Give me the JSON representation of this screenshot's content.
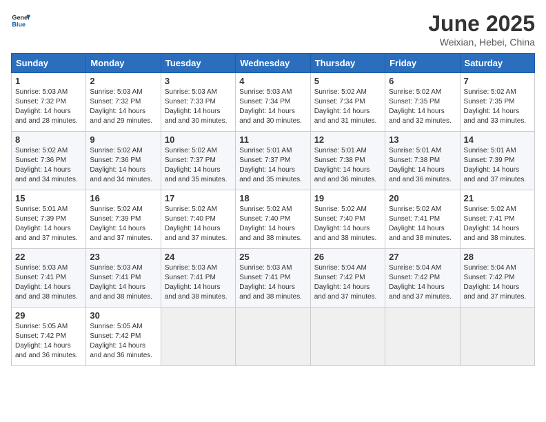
{
  "header": {
    "logo_general": "General",
    "logo_blue": "Blue",
    "title": "June 2025",
    "location": "Weixian, Hebei, China"
  },
  "columns": [
    "Sunday",
    "Monday",
    "Tuesday",
    "Wednesday",
    "Thursday",
    "Friday",
    "Saturday"
  ],
  "weeks": [
    [
      {
        "day": "1",
        "sunrise": "Sunrise: 5:03 AM",
        "sunset": "Sunset: 7:32 PM",
        "daylight": "Daylight: 14 hours and 28 minutes."
      },
      {
        "day": "2",
        "sunrise": "Sunrise: 5:03 AM",
        "sunset": "Sunset: 7:32 PM",
        "daylight": "Daylight: 14 hours and 29 minutes."
      },
      {
        "day": "3",
        "sunrise": "Sunrise: 5:03 AM",
        "sunset": "Sunset: 7:33 PM",
        "daylight": "Daylight: 14 hours and 30 minutes."
      },
      {
        "day": "4",
        "sunrise": "Sunrise: 5:03 AM",
        "sunset": "Sunset: 7:34 PM",
        "daylight": "Daylight: 14 hours and 30 minutes."
      },
      {
        "day": "5",
        "sunrise": "Sunrise: 5:02 AM",
        "sunset": "Sunset: 7:34 PM",
        "daylight": "Daylight: 14 hours and 31 minutes."
      },
      {
        "day": "6",
        "sunrise": "Sunrise: 5:02 AM",
        "sunset": "Sunset: 7:35 PM",
        "daylight": "Daylight: 14 hours and 32 minutes."
      },
      {
        "day": "7",
        "sunrise": "Sunrise: 5:02 AM",
        "sunset": "Sunset: 7:35 PM",
        "daylight": "Daylight: 14 hours and 33 minutes."
      }
    ],
    [
      {
        "day": "8",
        "sunrise": "Sunrise: 5:02 AM",
        "sunset": "Sunset: 7:36 PM",
        "daylight": "Daylight: 14 hours and 34 minutes."
      },
      {
        "day": "9",
        "sunrise": "Sunrise: 5:02 AM",
        "sunset": "Sunset: 7:36 PM",
        "daylight": "Daylight: 14 hours and 34 minutes."
      },
      {
        "day": "10",
        "sunrise": "Sunrise: 5:02 AM",
        "sunset": "Sunset: 7:37 PM",
        "daylight": "Daylight: 14 hours and 35 minutes."
      },
      {
        "day": "11",
        "sunrise": "Sunrise: 5:01 AM",
        "sunset": "Sunset: 7:37 PM",
        "daylight": "Daylight: 14 hours and 35 minutes."
      },
      {
        "day": "12",
        "sunrise": "Sunrise: 5:01 AM",
        "sunset": "Sunset: 7:38 PM",
        "daylight": "Daylight: 14 hours and 36 minutes."
      },
      {
        "day": "13",
        "sunrise": "Sunrise: 5:01 AM",
        "sunset": "Sunset: 7:38 PM",
        "daylight": "Daylight: 14 hours and 36 minutes."
      },
      {
        "day": "14",
        "sunrise": "Sunrise: 5:01 AM",
        "sunset": "Sunset: 7:39 PM",
        "daylight": "Daylight: 14 hours and 37 minutes."
      }
    ],
    [
      {
        "day": "15",
        "sunrise": "Sunrise: 5:01 AM",
        "sunset": "Sunset: 7:39 PM",
        "daylight": "Daylight: 14 hours and 37 minutes."
      },
      {
        "day": "16",
        "sunrise": "Sunrise: 5:02 AM",
        "sunset": "Sunset: 7:39 PM",
        "daylight": "Daylight: 14 hours and 37 minutes."
      },
      {
        "day": "17",
        "sunrise": "Sunrise: 5:02 AM",
        "sunset": "Sunset: 7:40 PM",
        "daylight": "Daylight: 14 hours and 37 minutes."
      },
      {
        "day": "18",
        "sunrise": "Sunrise: 5:02 AM",
        "sunset": "Sunset: 7:40 PM",
        "daylight": "Daylight: 14 hours and 38 minutes."
      },
      {
        "day": "19",
        "sunrise": "Sunrise: 5:02 AM",
        "sunset": "Sunset: 7:40 PM",
        "daylight": "Daylight: 14 hours and 38 minutes."
      },
      {
        "day": "20",
        "sunrise": "Sunrise: 5:02 AM",
        "sunset": "Sunset: 7:41 PM",
        "daylight": "Daylight: 14 hours and 38 minutes."
      },
      {
        "day": "21",
        "sunrise": "Sunrise: 5:02 AM",
        "sunset": "Sunset: 7:41 PM",
        "daylight": "Daylight: 14 hours and 38 minutes."
      }
    ],
    [
      {
        "day": "22",
        "sunrise": "Sunrise: 5:03 AM",
        "sunset": "Sunset: 7:41 PM",
        "daylight": "Daylight: 14 hours and 38 minutes."
      },
      {
        "day": "23",
        "sunrise": "Sunrise: 5:03 AM",
        "sunset": "Sunset: 7:41 PM",
        "daylight": "Daylight: 14 hours and 38 minutes."
      },
      {
        "day": "24",
        "sunrise": "Sunrise: 5:03 AM",
        "sunset": "Sunset: 7:41 PM",
        "daylight": "Daylight: 14 hours and 38 minutes."
      },
      {
        "day": "25",
        "sunrise": "Sunrise: 5:03 AM",
        "sunset": "Sunset: 7:41 PM",
        "daylight": "Daylight: 14 hours and 38 minutes."
      },
      {
        "day": "26",
        "sunrise": "Sunrise: 5:04 AM",
        "sunset": "Sunset: 7:42 PM",
        "daylight": "Daylight: 14 hours and 37 minutes."
      },
      {
        "day": "27",
        "sunrise": "Sunrise: 5:04 AM",
        "sunset": "Sunset: 7:42 PM",
        "daylight": "Daylight: 14 hours and 37 minutes."
      },
      {
        "day": "28",
        "sunrise": "Sunrise: 5:04 AM",
        "sunset": "Sunset: 7:42 PM",
        "daylight": "Daylight: 14 hours and 37 minutes."
      }
    ],
    [
      {
        "day": "29",
        "sunrise": "Sunrise: 5:05 AM",
        "sunset": "Sunset: 7:42 PM",
        "daylight": "Daylight: 14 hours and 36 minutes."
      },
      {
        "day": "30",
        "sunrise": "Sunrise: 5:05 AM",
        "sunset": "Sunset: 7:42 PM",
        "daylight": "Daylight: 14 hours and 36 minutes."
      },
      null,
      null,
      null,
      null,
      null
    ]
  ]
}
